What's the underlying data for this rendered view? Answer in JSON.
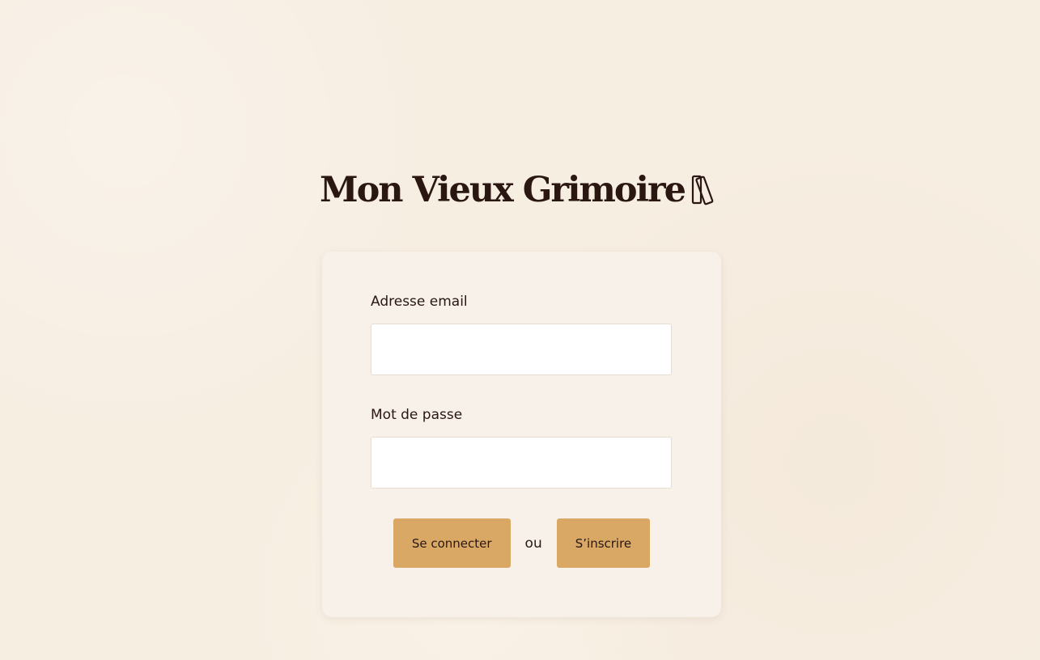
{
  "header": {
    "title": "Mon Vieux Grimoire",
    "icon": "books-icon"
  },
  "form": {
    "email_label": "Adresse email",
    "email_value": "",
    "password_label": "Mot de passe",
    "password_value": "",
    "login_label": "Se connecter",
    "separator": "ou",
    "signup_label": "S’inscrire"
  },
  "colors": {
    "background": "#f7eee2",
    "card": "#f7f1ea",
    "button": "#d9a864",
    "text": "#2a1712"
  }
}
